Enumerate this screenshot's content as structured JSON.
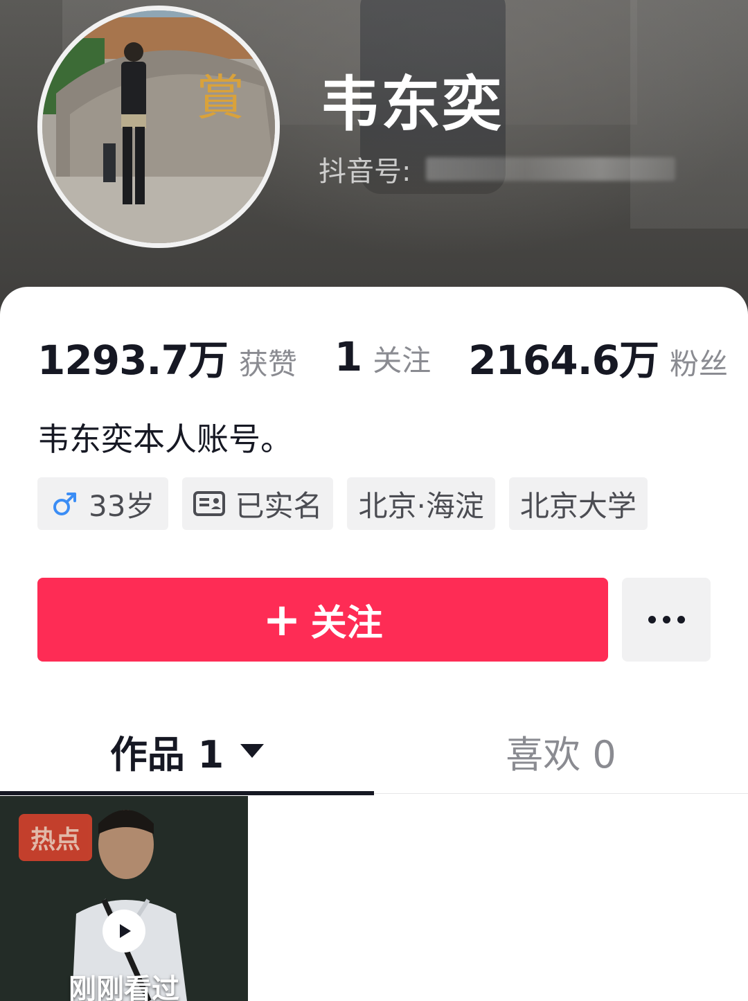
{
  "profile": {
    "nickname": "韦东奕",
    "douyin_id_label": "抖音号:",
    "bio": "韦东奕本人账号。"
  },
  "stats": [
    {
      "value": "1293.7万",
      "label": "获赞"
    },
    {
      "value": "1",
      "label": "关注"
    },
    {
      "value": "2164.6万",
      "label": "粉丝"
    }
  ],
  "tags": {
    "age": "33岁",
    "verified": "已实名",
    "location": "北京·海淀",
    "school": "北京大学"
  },
  "actions": {
    "follow_plus": "+",
    "follow_label": "关注"
  },
  "tabs": {
    "works": "作品 1",
    "likes": "喜欢 0"
  },
  "video": {
    "badge": "热点",
    "status": "刚刚看过"
  },
  "colors": {
    "accent": "#fe2c55",
    "male_icon": "#3b8df5",
    "text_primary": "#161823",
    "text_secondary": "#8a8b91"
  },
  "icons": {
    "male": "male-sign-icon",
    "id_card": "id-card-icon",
    "more": "more-dots-icon",
    "play": "play-icon",
    "caret": "caret-down-icon"
  }
}
